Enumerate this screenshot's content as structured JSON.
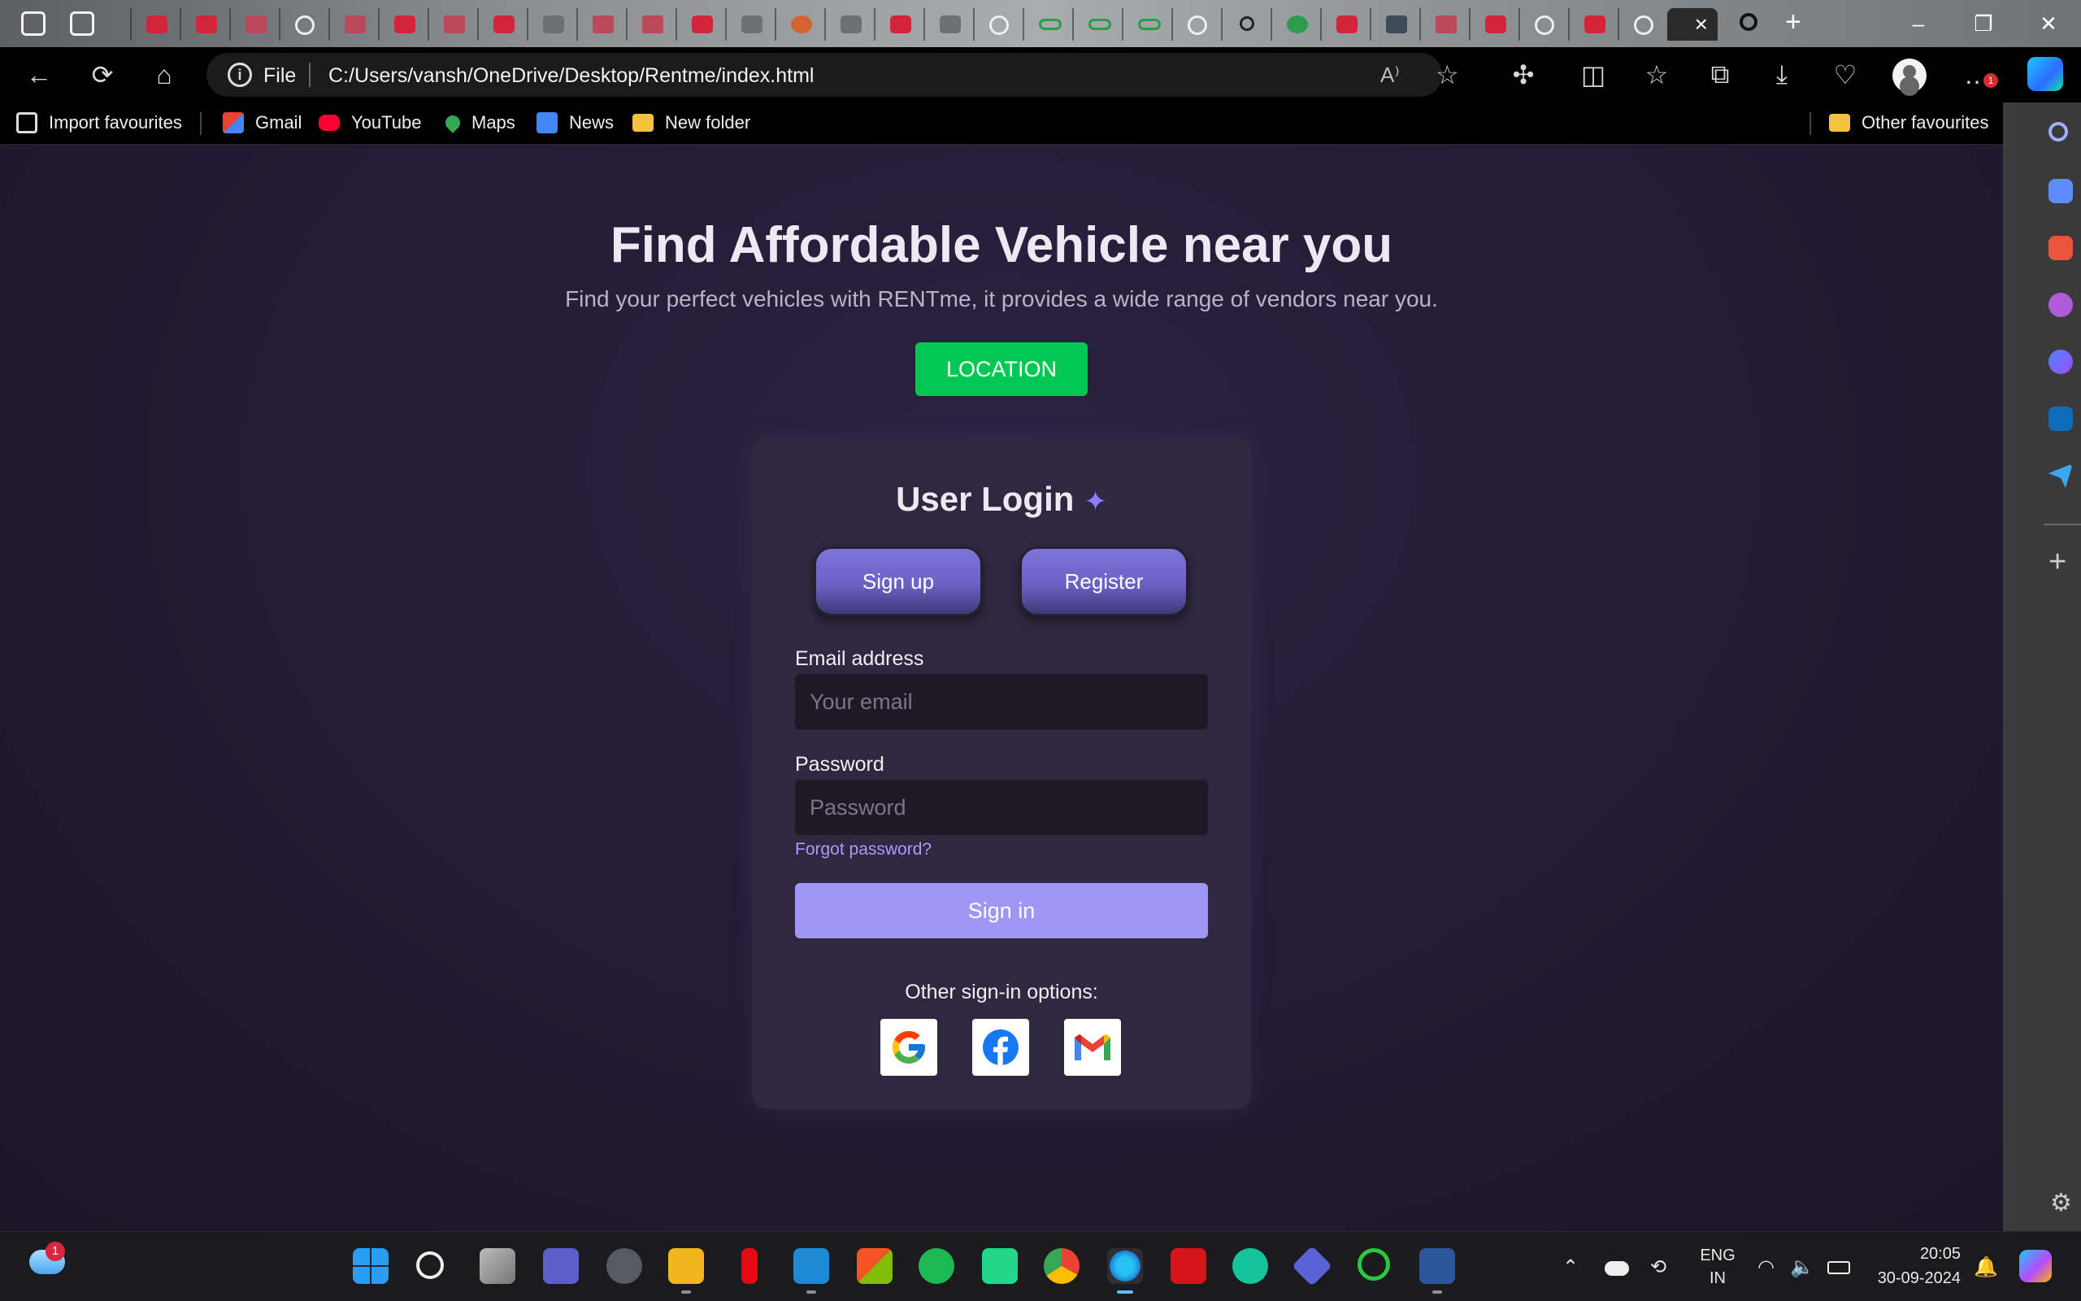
{
  "browser": {
    "tabs": [
      "yt",
      "yt",
      "pdf",
      "gpt",
      "pdf",
      "yt",
      "pdf",
      "yt",
      "misc",
      "pdf",
      "pdf",
      "yt",
      "misc",
      "ori",
      "misc",
      "yt",
      "misc",
      "gpt",
      "gfg",
      "gfg",
      "gfg",
      "gpt",
      "search",
      "gn",
      "yt",
      "hh",
      "pdf",
      "yt",
      "gpt",
      "yt",
      "gpt"
    ],
    "active_tab_close": "×",
    "new_tab": "+",
    "window_controls": {
      "minimize": "–",
      "restore": "❐",
      "close": "✕"
    }
  },
  "toolbar": {
    "file_label": "File",
    "url": "C:/Users/vansh/OneDrive/Desktop/Rentme/index.html",
    "read_aloud": "A⁾",
    "more_badge": "1"
  },
  "favourites": {
    "items": [
      {
        "label": "Import favourites",
        "icon": "import-icon"
      },
      {
        "label": "Gmail",
        "icon": "gmail-icon"
      },
      {
        "label": "YouTube",
        "icon": "youtube-icon"
      },
      {
        "label": "Maps",
        "icon": "maps-icon"
      },
      {
        "label": "News",
        "icon": "news-icon"
      },
      {
        "label": "New folder",
        "icon": "folder-icon"
      }
    ],
    "other": "Other favourites"
  },
  "page": {
    "hero_title": "Find Affordable Vehicle near you",
    "hero_subtitle": "Find your perfect vehicles with RENTme, it provides a wide range of vendors near you.",
    "location_button": "LOCATION",
    "login": {
      "title": "User Login",
      "sparkle": "✦",
      "signup_button": "Sign up",
      "register_button": "Register",
      "email_label": "Email address",
      "email_placeholder": "Your email",
      "password_label": "Password",
      "password_placeholder": "Password",
      "forgot_link": "Forgot password?",
      "signin_button": "Sign in",
      "other_options": "Other sign-in options:"
    }
  },
  "taskbar": {
    "weather_badge": "1",
    "lang_line1": "ENG",
    "lang_line2": "IN",
    "time": "20:05",
    "date": "30-09-2024"
  },
  "colors": {
    "accent_green": "#00c853",
    "accent_purple": "#a096f6",
    "link": "#a99cff"
  }
}
